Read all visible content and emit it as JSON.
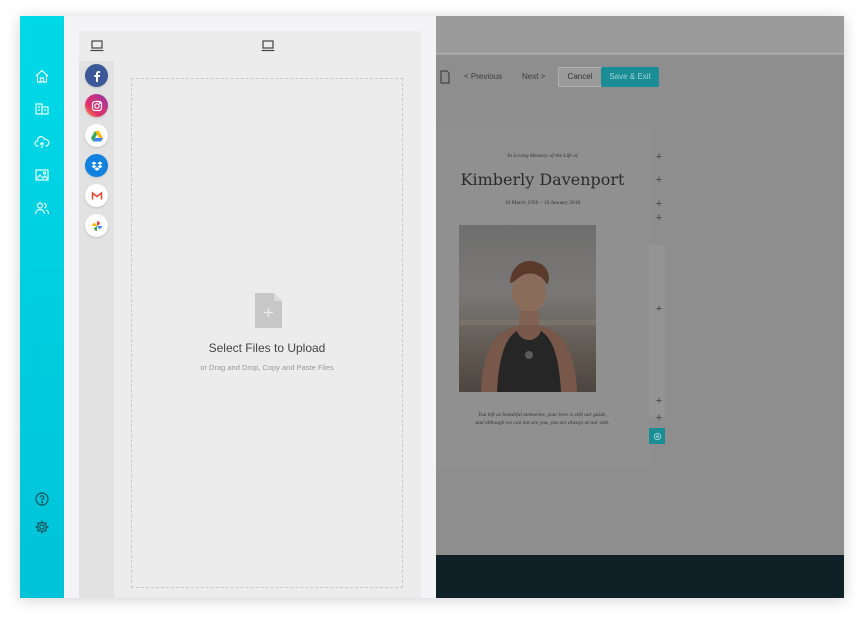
{
  "rail": {
    "top_icons": [
      "home-icon",
      "templates-icon",
      "upload-cloud-icon",
      "image-icon",
      "users-icon"
    ],
    "bottom_icons": [
      "help-icon",
      "settings-icon"
    ],
    "color_top": "#00d9e8",
    "color_bottom": "#00c3d9"
  },
  "picker": {
    "source_icons": [
      "device-icon",
      "facebook-icon",
      "instagram-icon",
      "google-drive-icon",
      "dropbox-icon",
      "gmail-icon",
      "google-photos-icon"
    ],
    "drop_title": "Select Files to Upload",
    "drop_subtitle": "or Drag and Drop, Copy and Paste Files"
  },
  "editor": {
    "toolbar": {
      "previous_label": "< Previous",
      "next_label": "Next >",
      "cancel_label": "Cancel",
      "save_label": "Save & Exit"
    },
    "card": {
      "line1": "In Loving Memory of the Life of",
      "name": "Kimberly Davenport",
      "dates": "10 March 1956 – 10 January 2018",
      "quote_line1": "You left us beautiful memories, your love is still our guide,",
      "quote_line2": "and although we can not see you, you are always at our side."
    },
    "accent_color": "#1a8d96",
    "footer_color": "#0f2026"
  }
}
